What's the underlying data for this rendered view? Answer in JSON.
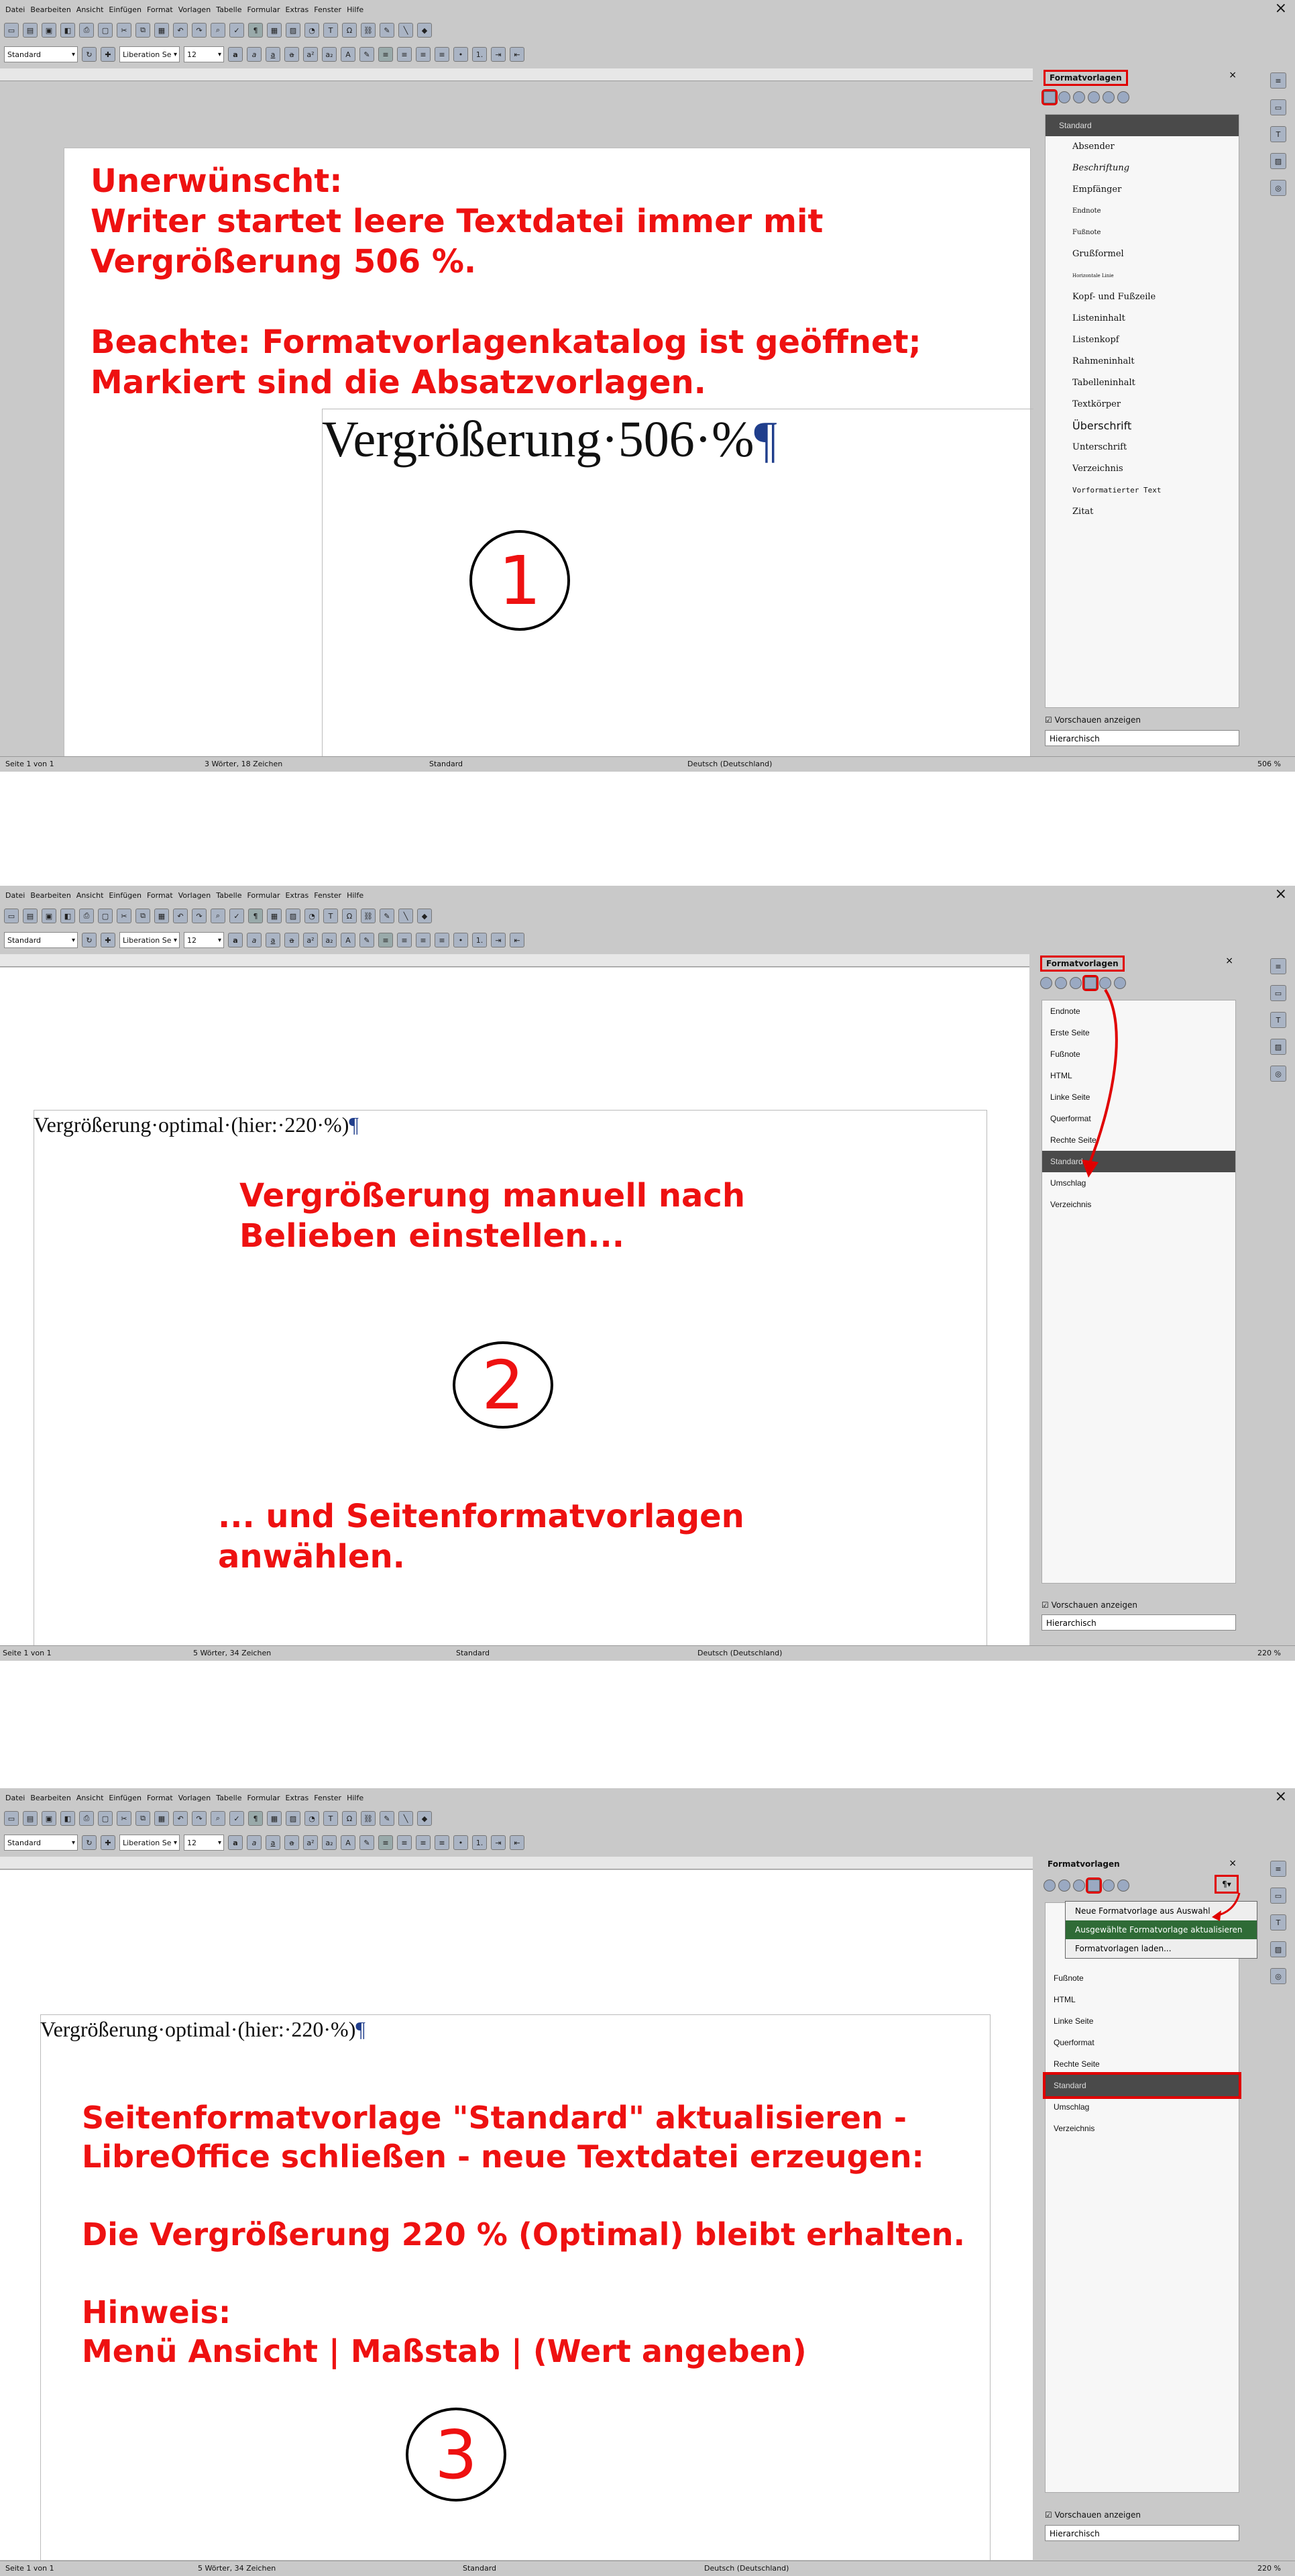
{
  "menu": [
    "Datei",
    "Bearbeiten",
    "Ansicht",
    "Einfügen",
    "Format",
    "Vorlagen",
    "Tabelle",
    "Formular",
    "Extras",
    "Fenster",
    "Hilfe"
  ],
  "toolbar": {
    "style_box": "Standard",
    "font_box": "Liberation Se",
    "size_box": "12"
  },
  "panel1": {
    "annotation": "Unerwünscht:\nWriter startet leere Textdatei immer mit\nVergrößerung 506 %.\n\nBeachte: Formatvorlagenkatalog ist geöffnet;\nMarkiert sind die Absatzvorlagen.",
    "doc_text": "Vergrößerung·506·%",
    "pilcrow": "¶",
    "number": "1",
    "sidebar_title": "Formatvorlagen",
    "styles": [
      "Standard",
      "Absender",
      "Beschriftung",
      "Empfänger",
      "Endnote",
      "Fußnote",
      "Grußformel",
      "Horizontale Linie",
      "Kopf- und Fußzeile",
      "Listeninhalt",
      "Listenkopf",
      "Rahmeninhalt",
      "Tabelleninhalt",
      "Textkörper",
      "Überschrift",
      "Unterschrift",
      "Verzeichnis",
      "Vorformatierter Text",
      "Zitat"
    ],
    "preview_label": "Vorschauen anzeigen",
    "view_mode": "Hierarchisch",
    "status": {
      "page": "Seite 1 von 1",
      "words": "3 Wörter, 18 Zeichen",
      "style": "Standard",
      "lang": "Deutsch (Deutschland)",
      "zoom": "506 %"
    }
  },
  "panel2": {
    "annotation_top": "Vergrößerung manuell nach\nBelieben einstellen...",
    "annotation_bottom": "... und Seitenformatvorlagen\nanwählen.",
    "doc_text": "Vergrößerung·optimal·(hier:·220·%)",
    "pilcrow": "¶",
    "number": "2",
    "sidebar_title": "Formatvorlagen",
    "styles": [
      "Endnote",
      "Erste Seite",
      "Fußnote",
      "HTML",
      "Linke Seite",
      "Querformat",
      "Rechte Seite",
      "Standard",
      "Umschlag",
      "Verzeichnis"
    ],
    "preview_label": "Vorschauen anzeigen",
    "view_mode": "Hierarchisch",
    "status": {
      "page": "Seite 1 von 1",
      "words": "5 Wörter, 34 Zeichen",
      "style": "Standard",
      "lang": "Deutsch (Deutschland)",
      "zoom": "220 %"
    }
  },
  "panel3": {
    "annotation": "Seitenformatvorlage \"Standard\" aktualisieren -\nLibreOffice schließen - neue Textdatei erzeugen:\n\nDie Vergrößerung 220 % (Optimal) bleibt erhalten.\n\nHinweis:\nMenü Ansicht | Maßstab | (Wert angeben)",
    "doc_text": "Vergrößerung·optimal·(hier:·220·%)",
    "pilcrow": "¶",
    "number": "3",
    "sidebar_title": "Formatvorlagen",
    "context_menu": [
      "Neue Formatvorlage aus Auswahl",
      "Ausgewählte Formatvorlage aktualisieren",
      "Formatvorlagen laden..."
    ],
    "styles": [
      "Fußnote",
      "HTML",
      "Linke Seite",
      "Querformat",
      "Rechte Seite",
      "Standard",
      "Umschlag",
      "Verzeichnis"
    ],
    "preview_label": "Vorschauen anzeigen",
    "view_mode": "Hierarchisch",
    "status": {
      "page": "Seite 1 von 1",
      "words": "5 Wörter, 34 Zeichen",
      "style": "Standard",
      "lang": "Deutsch (Deutschland)",
      "zoom": "220 %"
    }
  },
  "colors": {
    "annotation": "#ee1111",
    "highlight": "#e00000",
    "pilcrow": "#203e8c",
    "ui_gray": "#c9c9c9"
  }
}
